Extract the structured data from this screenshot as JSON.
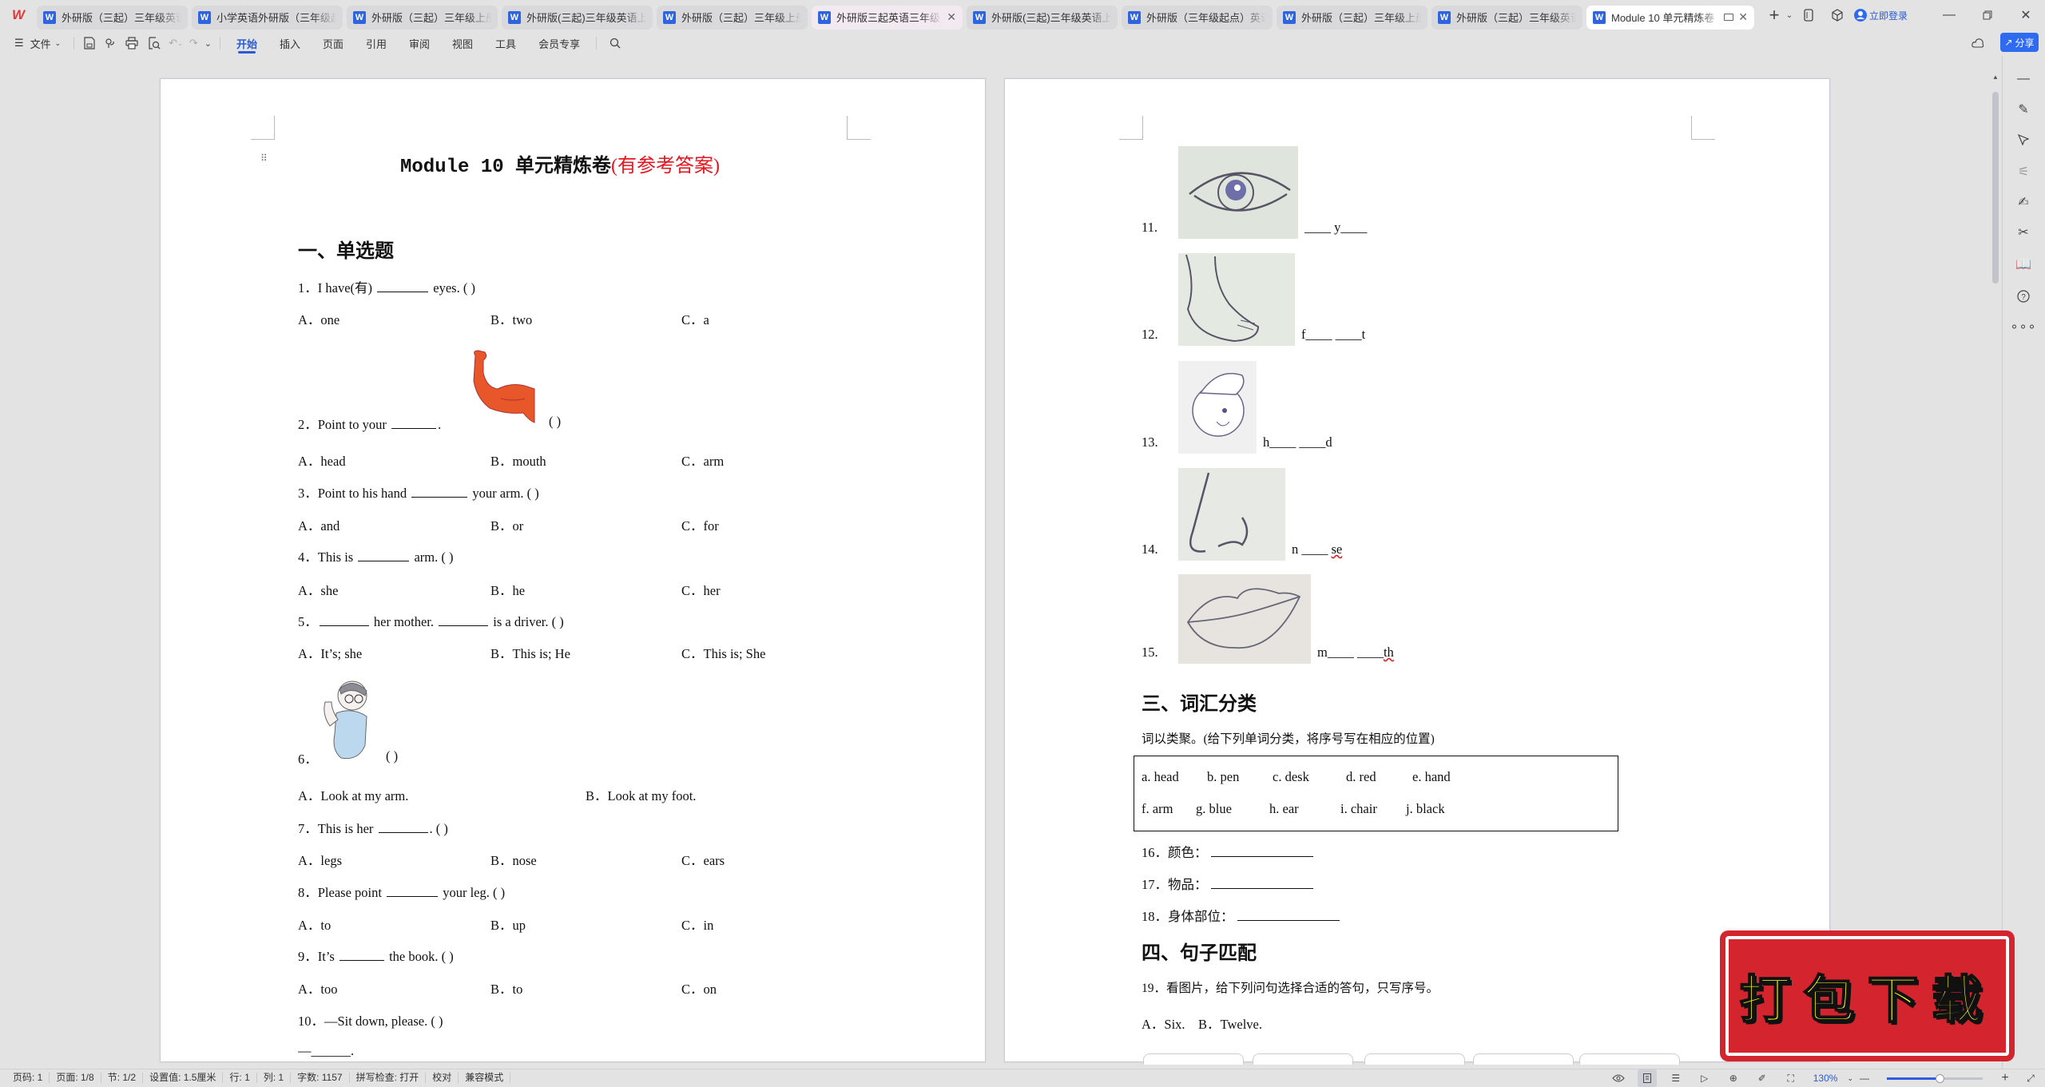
{
  "window": {
    "tabs": [
      {
        "label": "外研版（三起）三年级英语上册",
        "state": "normal"
      },
      {
        "label": "小学英语外研版（三年级起点）",
        "state": "normal"
      },
      {
        "label": "外研版（三起）三年级上册M",
        "state": "normal"
      },
      {
        "label": "外研版(三起)三年级英语上册",
        "state": "normal"
      },
      {
        "label": "外研版（三起）三年级上册M",
        "state": "normal"
      },
      {
        "label": "外研版三起英语三年级上册",
        "state": "highlighted"
      },
      {
        "label": "外研版(三起)三年级英语上册",
        "state": "normal"
      },
      {
        "label": "外研版（三年级起点）英语三",
        "state": "normal"
      },
      {
        "label": "外研版（三起）三年级上册",
        "state": "normal"
      },
      {
        "label": "外研版（三起）三年级英语",
        "state": "normal"
      },
      {
        "label": "Module 10 单元精炼卷",
        "state": "active"
      }
    ],
    "login_label": "立即登录",
    "share_label": "分享"
  },
  "ribbon": {
    "file_menu": "文件",
    "menus": [
      "开始",
      "插入",
      "页面",
      "引用",
      "审阅",
      "视图",
      "工具",
      "会员专享"
    ],
    "active_menu": "开始"
  },
  "document": {
    "title_main": "Module 10 单元精炼卷",
    "title_note": "(有参考答案)",
    "section1": "一、单选题",
    "questions": [
      {
        "n": "1．",
        "stem_parts": [
          "I have(有) ",
          " eyes. (       )"
        ],
        "options": [
          "A．one",
          "B．two",
          "C．a"
        ]
      },
      {
        "n": "2．",
        "stem_parts": [
          "Point to your ",
          "."
        ],
        "paren": "(   )",
        "image": "flexed-arm",
        "options": [
          "A．head",
          "B．mouth",
          "C．arm"
        ]
      },
      {
        "n": "3．",
        "stem_parts": [
          "Point to his hand ",
          " your arm. (     )"
        ],
        "options": [
          "A．and",
          "B．or",
          "C．for"
        ]
      },
      {
        "n": "4．",
        "stem_parts": [
          "This is ",
          " arm. (       )"
        ],
        "options": [
          "A．she",
          "B．he",
          "C．her"
        ]
      },
      {
        "n": "5．",
        "stem_parts": [
          "",
          " her mother. ",
          " is a driver. (     )"
        ],
        "options": [
          "A．It’s; she",
          "B．This is; He",
          "C．This is; She"
        ]
      },
      {
        "n": "6．",
        "paren": "(       )",
        "image": "boy-holding-foot",
        "options": [
          "A．Look at my arm.",
          "B．Look at my foot."
        ]
      },
      {
        "n": "7．",
        "stem_parts": [
          "This is her ",
          ". (     )"
        ],
        "options": [
          "A．legs",
          "B．nose",
          "C．ears"
        ]
      },
      {
        "n": "8．",
        "stem_parts": [
          "Please point ",
          " your leg. (     )"
        ],
        "options": [
          "A．to",
          "B．up",
          "C．in"
        ]
      },
      {
        "n": "9．",
        "stem_parts": [
          "It’s ",
          " the book. (       )"
        ],
        "options": [
          "A．too",
          "B．to",
          "C．on"
        ]
      },
      {
        "n": "10．",
        "stem_parts": [
          "—Sit down, please. (   )"
        ],
        "answer_line": "—______."
      }
    ],
    "spelling": [
      {
        "n": "11.",
        "image": "eye",
        "pattern": "____ y____"
      },
      {
        "n": "12.",
        "image": "foot",
        "pattern": "f____ ____t"
      },
      {
        "n": "13.",
        "image": "head",
        "pattern": "h____ ____d"
      },
      {
        "n": "14.",
        "image": "nose",
        "pattern_parts": [
          "n ____ ",
          "se"
        ]
      },
      {
        "n": "15.",
        "image": "mouth",
        "pattern_parts": [
          "m____ ____",
          "th"
        ]
      }
    ],
    "section3": "三、词汇分类",
    "section3_instruction": "词以类聚。(给下列单词分类，将序号写在相应的位置)",
    "words_row1": [
      "a. head",
      "b. pen",
      "c. desk",
      "d. red",
      "e. hand"
    ],
    "words_row2": [
      "f. arm",
      "g. blue",
      "h. ear",
      "i. chair",
      "j. black"
    ],
    "categories": [
      {
        "n": "16．",
        "label": "颜色："
      },
      {
        "n": "17．",
        "label": "物品："
      },
      {
        "n": "18．",
        "label": "身体部位："
      }
    ],
    "section4": "四、句子匹配",
    "q19": "19．看图片，给下列问句选择合适的答句，只写序号。",
    "q19_options": "A．Six.    B．Twelve."
  },
  "overlay": {
    "download_stamp": "打包下载"
  },
  "statusbar": {
    "items": [
      "页码: 1",
      "页面: 1/8",
      "节: 1/2",
      "设置值: 1.5厘米",
      "行: 1",
      "列: 1",
      "字数: 1157",
      "拼写检查: 打开",
      "校对",
      "兼容模式"
    ],
    "zoom": "130%",
    "zoom_fraction": 0.55
  },
  "colors": {
    "accent": "#2a5ad8",
    "title_red": "#e8141e",
    "stamp_red": "#d4252f",
    "stamp_text": "#ffff1e"
  }
}
